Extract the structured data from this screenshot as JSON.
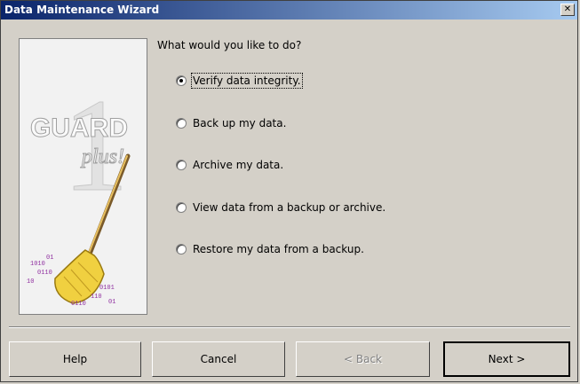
{
  "window": {
    "title": "Data Maintenance Wizard",
    "close_glyph": "✕"
  },
  "art": {
    "logo_text": "GUARD",
    "logo_sub": "plus!",
    "logo_digit": "1"
  },
  "main": {
    "question": "What would you like to do?",
    "options": [
      {
        "label": "Verify data integrity.",
        "checked": true
      },
      {
        "label": "Back up my data.",
        "checked": false
      },
      {
        "label": "Archive my data.",
        "checked": false
      },
      {
        "label": "View data from a backup or archive.",
        "checked": false
      },
      {
        "label": "Restore my data from a backup.",
        "checked": false
      }
    ]
  },
  "buttons": {
    "help": "Help",
    "cancel": "Cancel",
    "back": "< Back",
    "next": "Next >"
  }
}
